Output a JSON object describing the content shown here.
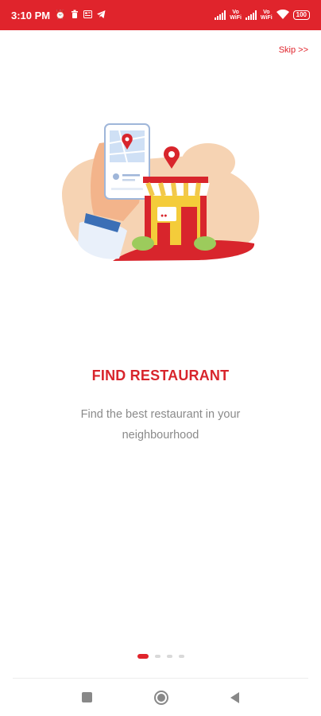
{
  "status_bar": {
    "time": "3:10 PM",
    "left_icons": [
      "alarm-icon",
      "trash-icon",
      "message-icon",
      "telegram-icon"
    ],
    "network_label_1": "Vo\nWiFi",
    "network_label_2": "Vo\nWiFi",
    "battery": "100",
    "color": "#e0242c"
  },
  "skip": {
    "label": "Skip >>"
  },
  "onboarding": {
    "title": "FIND RESTAURANT",
    "description": "Find the best restaurant in your neighbourhood",
    "total_pages": 4,
    "current_page": 1,
    "accent_color": "#d8252c"
  },
  "nav": {
    "recents": "recents-square-icon",
    "home": "home-circle-icon",
    "back": "back-triangle-icon"
  }
}
